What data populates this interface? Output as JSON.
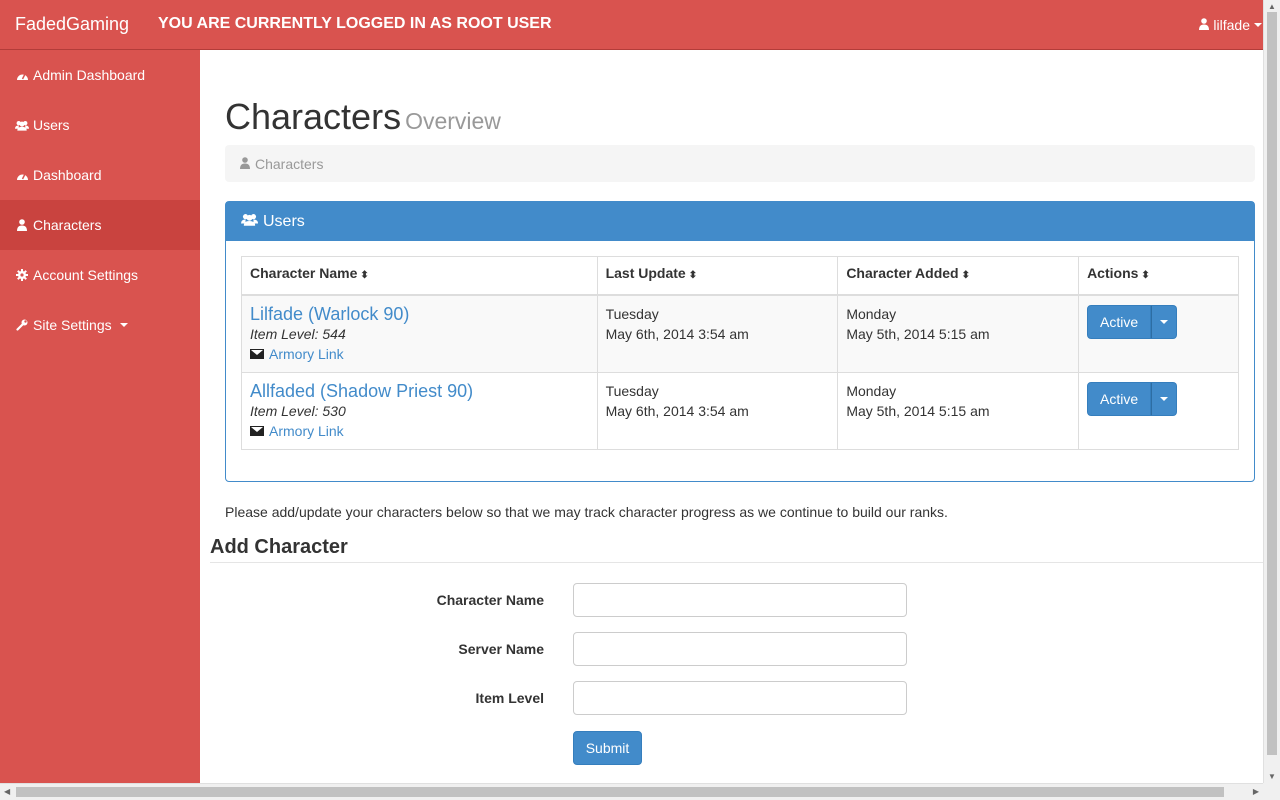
{
  "topbar": {
    "brand": "FadedGaming",
    "notice": "YOU ARE CURRENTLY LOGGED IN AS ROOT USER",
    "user": "lilfade",
    "accent": "#d9534f"
  },
  "sidebar": {
    "items": [
      {
        "label": "Admin Dashboard",
        "icon": "dashboard-icon"
      },
      {
        "label": "Users",
        "icon": "users-icon"
      },
      {
        "label": "Dashboard",
        "icon": "dashboard-icon"
      },
      {
        "label": "Characters",
        "icon": "user-icon",
        "active": true
      },
      {
        "label": "Account Settings",
        "icon": "gear-icon"
      },
      {
        "label": "Site Settings",
        "icon": "wrench-icon"
      }
    ]
  },
  "page": {
    "title": "Characters",
    "subtitle": "Overview",
    "breadcrumb": "Characters"
  },
  "panel": {
    "title": "Users",
    "color": "#428bca",
    "columns": [
      "Character Name",
      "Last Update",
      "Character Added",
      "Actions"
    ],
    "rows": [
      {
        "name": "Lilfade (Warlock 90)",
        "item_level_label": "Item Level:",
        "item_level": "544",
        "armory": "Armory Link",
        "last_update_day": "Tuesday",
        "last_update_date": "May 6th, 2014 3:54 am",
        "added_day": "Monday",
        "added_date": "May 5th, 2014 5:15 am",
        "status": "Active"
      },
      {
        "name": "Allfaded (Shadow Priest 90)",
        "item_level_label": "Item Level:",
        "item_level": "530",
        "armory": "Armory Link",
        "last_update_day": "Tuesday",
        "last_update_date": "May 6th, 2014 3:54 am",
        "added_day": "Monday",
        "added_date": "May 5th, 2014 5:15 am",
        "status": "Active"
      }
    ]
  },
  "note": "Please add/update your characters below so that we may track character progress as we continue to build our ranks.",
  "form": {
    "title": "Add Character",
    "fields": [
      {
        "label": "Character Name",
        "value": ""
      },
      {
        "label": "Server Name",
        "value": ""
      },
      {
        "label": "Item Level",
        "value": ""
      }
    ],
    "submit": "Submit"
  }
}
